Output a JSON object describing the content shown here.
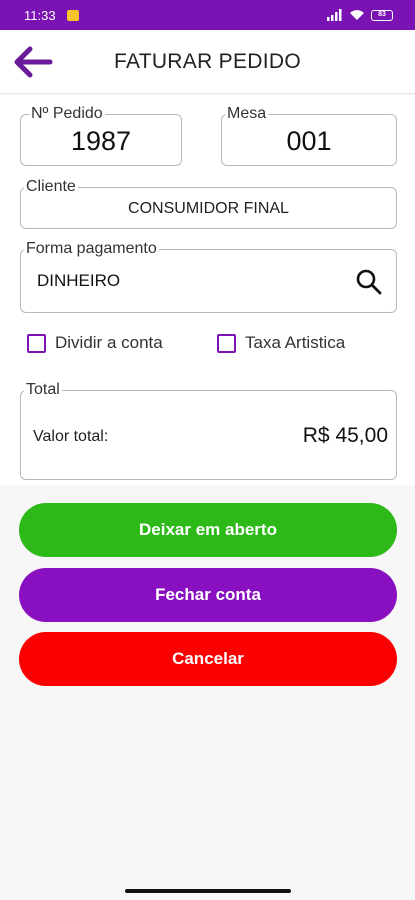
{
  "status_bar": {
    "time": "11:33",
    "battery": "83"
  },
  "header": {
    "title": "FATURAR PEDIDO",
    "back_icon": "arrow-left-icon"
  },
  "pedido": {
    "label": "Nº Pedido",
    "value": "1987"
  },
  "mesa": {
    "label": "Mesa",
    "value": "001"
  },
  "cliente": {
    "label": "Cliente",
    "value": "CONSUMIDOR FINAL"
  },
  "pagamento": {
    "label": "Forma pagamento",
    "value": "DINHEIRO",
    "search_icon": "search-icon"
  },
  "options": {
    "dividir_conta": {
      "label": "Dividir a conta",
      "checked": false
    },
    "taxa_artistica": {
      "label": "Taxa Artistica",
      "checked": false
    }
  },
  "total": {
    "label": "Total",
    "valor_label": "Valor total:",
    "valor": "R$ 45,00"
  },
  "buttons": {
    "deixar_aberto": "Deixar em aberto",
    "fechar_conta": "Fechar conta",
    "cancelar": "Cancelar"
  },
  "colors": {
    "primary": "#7b12b3",
    "green": "#2db918",
    "purple": "#8810c0",
    "red": "#fb0000"
  }
}
